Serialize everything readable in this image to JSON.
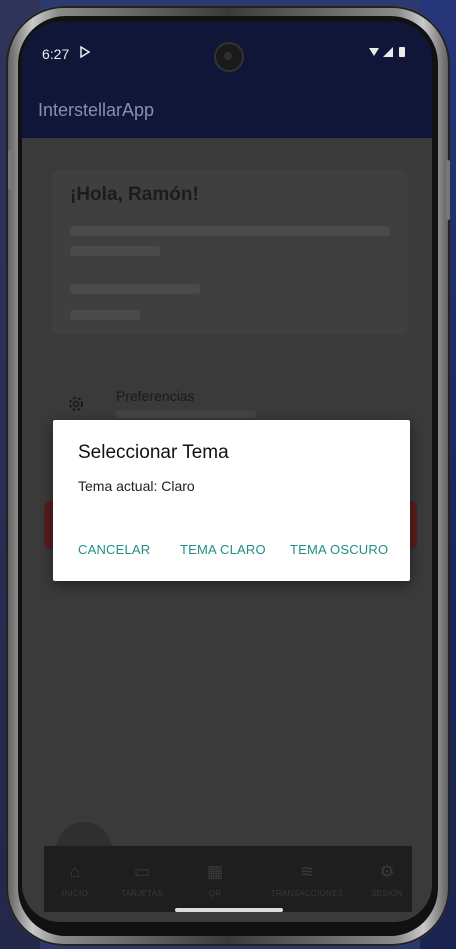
{
  "status": {
    "time": "6:27",
    "cast_icon": "play-outline-icon",
    "icons": "▾◢▮"
  },
  "appbar": {
    "title": "InterstellarApp"
  },
  "card": {
    "greeting": "¡Hola, Ramón!"
  },
  "preferences": {
    "title": "Preferencias",
    "icon": "gear-icon"
  },
  "dialog": {
    "title": "Seleccionar Tema",
    "message": "Tema actual: Claro",
    "cancel": "CANCELAR",
    "light": "TEMA CLARO",
    "dark": "TEMA OSCURO"
  },
  "nav": [
    {
      "label": "INICIO",
      "icon": "home-icon"
    },
    {
      "label": "TARJETAS",
      "icon": "card-icon"
    },
    {
      "label": "QR",
      "icon": "qr-icon"
    },
    {
      "label": "TRANSACCIONES",
      "icon": "transactions-icon"
    },
    {
      "label": "SESIÓN",
      "icon": "gear-icon"
    }
  ],
  "colors": {
    "accent": "#1f8f86",
    "appbar": "#0f1637",
    "scrim_bg": "#3a3a3a"
  }
}
